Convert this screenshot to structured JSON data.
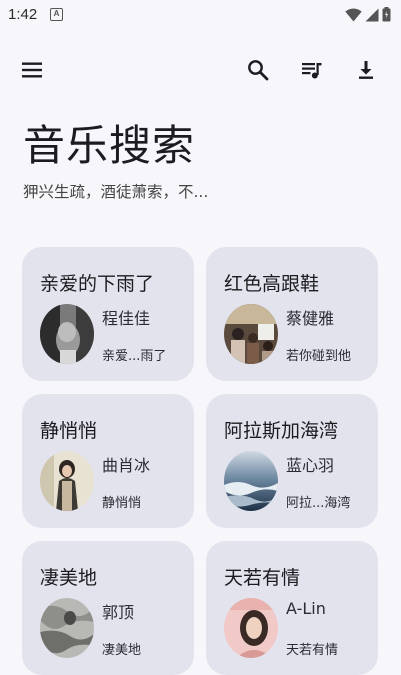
{
  "status": {
    "time": "1:42",
    "notif_glyph": "A"
  },
  "toolbar": {
    "menu_icon": "menu-icon",
    "search_icon": "search-icon",
    "playlist_icon": "queue-music-icon",
    "download_icon": "download-icon"
  },
  "header": {
    "title": "音乐搜索",
    "subtitle": "狎兴生疏，酒徒萧索，不..."
  },
  "cards": [
    {
      "title": "亲爱的下雨了",
      "artist": "程佳佳",
      "song": "亲爱...雨了"
    },
    {
      "title": "红色高跟鞋",
      "artist": "蔡健雅",
      "song": "若你碰到他"
    },
    {
      "title": "静悄悄",
      "artist": "曲肖冰",
      "song": "静悄悄"
    },
    {
      "title": "阿拉斯加海湾",
      "artist": "蓝心羽",
      "song": "阿拉...海湾"
    },
    {
      "title": "凄美地",
      "artist": "郭顶",
      "song": "凄美地"
    },
    {
      "title": "天若有情",
      "artist": "A-Lin",
      "song": "天若有情"
    }
  ],
  "colors": {
    "background": "#f7f6fb",
    "card": "#e2e3ec",
    "text": "#1c1b1f"
  }
}
